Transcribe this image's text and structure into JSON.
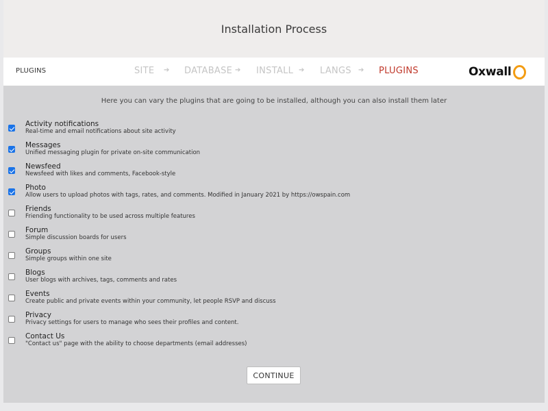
{
  "header": {
    "title": "Installation Process"
  },
  "steps_bar": {
    "current_label": "PLUGINS",
    "steps": [
      {
        "label": "SITE",
        "active": false
      },
      {
        "label": "DATABASE",
        "active": false
      },
      {
        "label": "INSTALL",
        "active": false
      },
      {
        "label": "LANGS",
        "active": false
      },
      {
        "label": "PLUGINS",
        "active": true
      }
    ],
    "arrow_icon": "arrow-right-icon",
    "logo_text": "Oxwall",
    "logo_ring_color": "#f39c12",
    "active_color": "#c0392b"
  },
  "main": {
    "intro": "Here you can vary the plugins that are going to be installed, although you can also install them later",
    "plugins": [
      {
        "name": "Activity notifications",
        "description": "Real-time and email notifications about site activity",
        "checked": true
      },
      {
        "name": "Messages",
        "description": "Unified messaging plugin for private on-site communication",
        "checked": true
      },
      {
        "name": "Newsfeed",
        "description": "Newsfeed with likes and comments, Facebook-style",
        "checked": true
      },
      {
        "name": "Photo",
        "description": "Allow users to upload photos with tags, rates, and comments. Modified in January 2021 by https://owspain.com",
        "checked": true
      },
      {
        "name": "Friends",
        "description": "Friending functionality to be used across multiple features",
        "checked": false
      },
      {
        "name": "Forum",
        "description": "Simple discussion boards for users",
        "checked": false
      },
      {
        "name": "Groups",
        "description": "Simple groups within one site",
        "checked": false
      },
      {
        "name": "Blogs",
        "description": "User blogs with archives, tags, comments and rates",
        "checked": false
      },
      {
        "name": "Events",
        "description": "Create public and private events within your community, let people RSVP and discuss",
        "checked": false
      },
      {
        "name": "Privacy",
        "description": "Privacy settings for users to manage who sees their profiles and content.",
        "checked": false
      },
      {
        "name": "Contact Us",
        "description": "\"Contact us\" page with the ability to choose departments (email addresses)",
        "checked": false
      }
    ],
    "continue_label": "CONTINUE"
  }
}
